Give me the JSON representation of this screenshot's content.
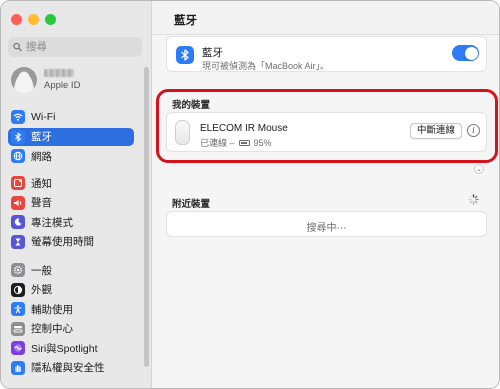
{
  "sidebar": {
    "search_placeholder": "搜尋",
    "profile_sub": "Apple ID",
    "groups": [
      [
        {
          "label": "Wi-Fi",
          "icon": "wifi-icon",
          "color": "#2d7cf6"
        },
        {
          "label": "藍牙",
          "icon": "bluetooth-icon",
          "color": "#2d7cf6",
          "selected": true
        },
        {
          "label": "網路",
          "icon": "globe-icon",
          "color": "#2d7cf6"
        }
      ],
      [
        {
          "label": "通知",
          "icon": "notification-icon",
          "color": "#e8453c"
        },
        {
          "label": "聲音",
          "icon": "speaker-icon",
          "color": "#e8453c"
        },
        {
          "label": "專注模式",
          "icon": "moon-icon",
          "color": "#5856d6"
        },
        {
          "label": "螢幕使用時間",
          "icon": "hourglass-icon",
          "color": "#5856d6"
        }
      ],
      [
        {
          "label": "一般",
          "icon": "gear-icon",
          "color": "#8e8e93"
        },
        {
          "label": "外觀",
          "icon": "appearance-icon",
          "color": "#1d1d1f"
        },
        {
          "label": "輔助使用",
          "icon": "accessibility-icon",
          "color": "#2d7cf6"
        },
        {
          "label": "控制中心",
          "icon": "control-center-icon",
          "color": "#8e8e93"
        },
        {
          "label": "Siri與Spotlight",
          "icon": "siri-icon",
          "color": "#7b3fe4"
        },
        {
          "label": "隱私權與安全性",
          "icon": "hand-icon",
          "color": "#2d7cf6"
        }
      ]
    ]
  },
  "main": {
    "title": "藍牙",
    "bluetooth": {
      "title": "藍牙",
      "subtitle": "現可被偵測為「MacBook Air」。",
      "enabled": true
    },
    "my_devices": {
      "title": "我的裝置",
      "device_name": "ELECOM IR Mouse",
      "status_prefix": "已連線 –",
      "battery": "95%",
      "battery_level": 0.95,
      "disconnect_label": "中斷連線",
      "info_label": "i"
    },
    "nearby": {
      "title": "附近裝置",
      "searching": "搜尋中⋯"
    }
  },
  "colors": {
    "accent": "#2d7cf6",
    "selection": "#2d6fe0",
    "highlight_frame": "#d8121a"
  }
}
